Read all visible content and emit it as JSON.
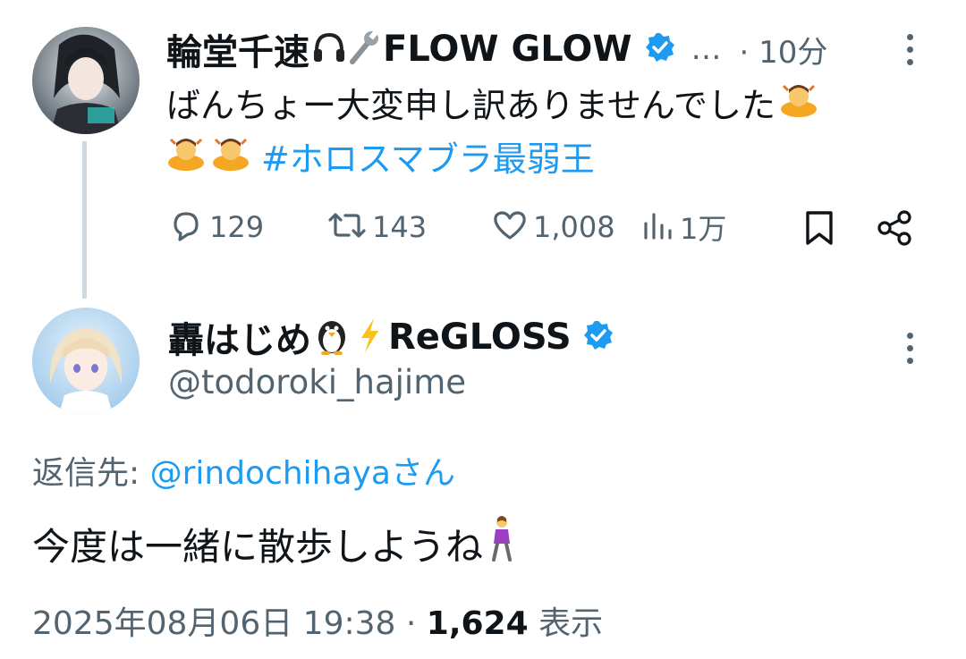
{
  "parent_tweet": {
    "display_name": "輪堂千速",
    "org": "FLOW GLOW",
    "ellipsis": "…",
    "time": "· 10分",
    "text_line1": "ばんちょー大変申し訳ありませんでした",
    "hashtag": "#ホロスマブラ最弱王",
    "actions": {
      "replies": "129",
      "reposts": "143",
      "likes": "1,008",
      "views": "1万"
    }
  },
  "reply_tweet": {
    "display_name": "轟はじめ",
    "org": "ReGLOSS",
    "handle": "@todoroki_hajime",
    "reply_to_label": "返信先: ",
    "reply_to_user": "@rindochihaya",
    "reply_to_suffix": "さん",
    "text": "今度は一緒に散歩しようね",
    "date": "2025年08月06日 19:38 · ",
    "views_count": "1,624",
    "views_label": " 表示"
  },
  "colors": {
    "accent": "#1d9bf0",
    "muted": "#536471",
    "text": "#0f1419",
    "thread_line": "#cfd9de"
  },
  "icons": {
    "verified": "verified-badge-icon",
    "headphones": "headphones-emoji",
    "wrench": "wrench-emoji",
    "penguin": "penguin-emoji",
    "lightning": "lightning-emoji",
    "bow": "bowing-person-emoji",
    "walker": "walking-woman-emoji",
    "reply": "reply-icon",
    "repost": "repost-icon",
    "like": "like-icon",
    "views": "views-icon",
    "bookmark": "bookmark-icon",
    "share": "share-icon",
    "more": "more-icon"
  }
}
